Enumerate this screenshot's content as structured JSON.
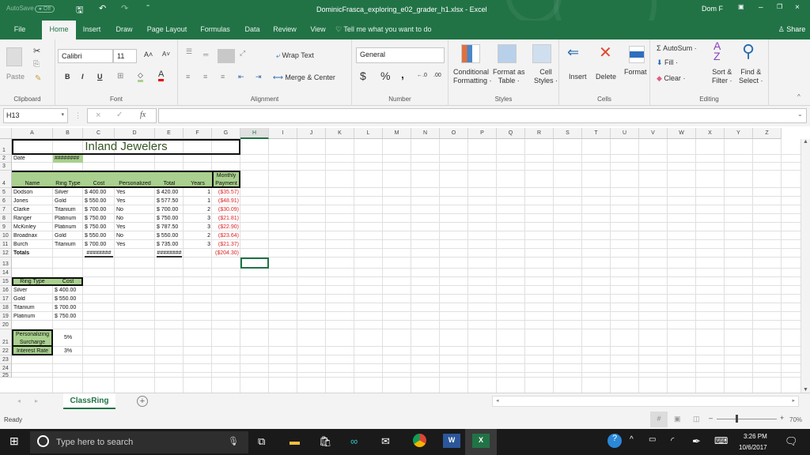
{
  "titlebar": {
    "autosave_label": "AutoSave",
    "autosave_state": "Off",
    "title": "DominicFrasca_exploring_e02_grader_h1.xlsx  -  Excel",
    "user": "Dom F"
  },
  "tabs": [
    {
      "label": "File"
    },
    {
      "label": "Home",
      "active": true
    },
    {
      "label": "Insert"
    },
    {
      "label": "Draw"
    },
    {
      "label": "Page Layout"
    },
    {
      "label": "Formulas"
    },
    {
      "label": "Data"
    },
    {
      "label": "Review"
    },
    {
      "label": "View"
    }
  ],
  "tell_me": "Tell me what you want to do",
  "share": "Share",
  "ribbon": {
    "clipboard": {
      "label": "Clipboard",
      "paste": "Paste"
    },
    "font": {
      "label": "Font",
      "name": "Calibri",
      "size": "11",
      "bold": "B",
      "italic": "I",
      "underline": "U"
    },
    "alignment": {
      "label": "Alignment",
      "wrap": "Wrap Text",
      "merge": "Merge & Center"
    },
    "number": {
      "label": "Number",
      "format": "General",
      "currency": "$",
      "percent": "%",
      "comma": ","
    },
    "styles": {
      "label": "Styles",
      "conditional1": "Conditional",
      "conditional2": "Formatting",
      "format_table1": "Format as",
      "format_table2": "Table",
      "cell_styles1": "Cell",
      "cell_styles2": "Styles"
    },
    "cells": {
      "label": "Cells",
      "insert": "Insert",
      "delete": "Delete",
      "format": "Format"
    },
    "editing": {
      "label": "Editing",
      "autosum": "AutoSum",
      "fill": "Fill",
      "clear": "Clear",
      "sort1": "Sort &",
      "sort2": "Filter",
      "find1": "Find &",
      "find2": "Select"
    }
  },
  "formula_bar": {
    "name_box": "H13",
    "formula": ""
  },
  "columns": [
    "A",
    "B",
    "C",
    "D",
    "E",
    "F",
    "G",
    "H",
    "I",
    "J",
    "K",
    "L",
    "M",
    "N",
    "O",
    "P",
    "Q",
    "R",
    "S",
    "T",
    "U",
    "V",
    "W",
    "X",
    "Y",
    "Z"
  ],
  "selected_column": "H",
  "rows": [
    "1",
    "2",
    "3",
    "4",
    "5",
    "6",
    "7",
    "8",
    "9",
    "10",
    "11",
    "12",
    "13",
    "14",
    "15",
    "16",
    "17",
    "18",
    "19",
    "20",
    "21",
    "22",
    "23",
    "24",
    "25"
  ],
  "sheet": {
    "title": "Inland Jewelers",
    "date_label": "Date",
    "date_value": "########",
    "headers": [
      "Name",
      "Ring Type",
      "Cost",
      "Personalized",
      "Total",
      "Years",
      "Monthly",
      "Payment"
    ],
    "records": [
      {
        "name": "Dodson",
        "ring": "Silver",
        "cost": "$  400.00",
        "pers": "Yes",
        "total": "$  420.00",
        "years": "1",
        "payment": "($35.57)"
      },
      {
        "name": "Jones",
        "ring": "Gold",
        "cost": "$  550.00",
        "pers": "Yes",
        "total": "$  577.50",
        "years": "1",
        "payment": "($48.91)"
      },
      {
        "name": "Clarke",
        "ring": "Titanium",
        "cost": "$  700.00",
        "pers": "No",
        "total": "$  700.00",
        "years": "2",
        "payment": "($30.09)"
      },
      {
        "name": "Ranger",
        "ring": "Platinum",
        "cost": "$  750.00",
        "pers": "No",
        "total": "$  750.00",
        "years": "3",
        "payment": "($21.81)"
      },
      {
        "name": "McKinley",
        "ring": "Platinum",
        "cost": "$  750.00",
        "pers": "Yes",
        "total": "$  787.50",
        "years": "3",
        "payment": "($22.90)"
      },
      {
        "name": "Broadnax",
        "ring": "Gold",
        "cost": "$  550.00",
        "pers": "No",
        "total": "$  550.00",
        "years": "2",
        "payment": "($23.64)"
      },
      {
        "name": "Burch",
        "ring": "Titanium",
        "cost": "$  700.00",
        "pers": "Yes",
        "total": "$  735.00",
        "years": "3",
        "payment": "($21.37)"
      }
    ],
    "totals_label": "Totals",
    "totals_cost": "########",
    "totals_total": "########",
    "totals_payment": "($204.30)",
    "lookup_headers": [
      "Ring Type",
      "Cost"
    ],
    "lookup": [
      {
        "ring": "Silver",
        "cost": "$ 400.00"
      },
      {
        "ring": "Gold",
        "cost": "$ 550.00"
      },
      {
        "ring": "Titanium",
        "cost": "$ 700.00"
      },
      {
        "ring": "Platinum",
        "cost": "$ 750.00"
      }
    ],
    "surcharge_label1": "Personalizing",
    "surcharge_label2": "Surcharge",
    "surcharge_value": "5%",
    "interest_label": "Interest Rate",
    "interest_value": "3%"
  },
  "sheet_tab": "ClassRing",
  "status": {
    "text": "Ready",
    "zoom": "70%",
    "zoom_level": 0.7
  },
  "taskbar": {
    "search_placeholder": "Type here to search",
    "time": "3:26 PM",
    "date": "10/6/2017"
  }
}
